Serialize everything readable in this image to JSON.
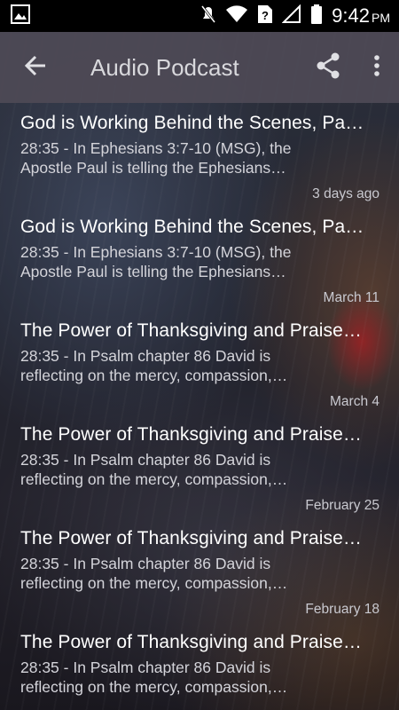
{
  "status_bar": {
    "time": "9:42",
    "ampm": "PM",
    "icons": [
      "image-icon",
      "mute-icon",
      "wifi-icon",
      "sim-unknown-icon",
      "signal-icon",
      "battery-icon"
    ]
  },
  "app_bar": {
    "title": "Audio Podcast",
    "back_icon": "arrow-back-icon",
    "share_icon": "share-icon",
    "more_icon": "more-vert-icon"
  },
  "episodes": [
    {
      "title": "God is Working Behind the Scenes, Pa…",
      "desc_line1": "28:35 - In Ephesians 3:7-10 (MSG), the",
      "desc_line2": "Apostle Paul is telling the Ephesians…",
      "date": "3 days ago"
    },
    {
      "title": "God is Working Behind the Scenes, Pa…",
      "desc_line1": "28:35 - In Ephesians 3:7-10 (MSG), the",
      "desc_line2": "Apostle Paul is telling the Ephesians…",
      "date": "March 11"
    },
    {
      "title": "The Power of Thanksgiving and Praise…",
      "desc_line1": "28:35 - In Psalm chapter 86 David is",
      "desc_line2": "reflecting on the mercy, compassion,…",
      "date": "March 4"
    },
    {
      "title": "The Power of Thanksgiving and Praise…",
      "desc_line1": "28:35 - In Psalm chapter 86 David is",
      "desc_line2": "reflecting on the mercy, compassion,…",
      "date": "February 25"
    },
    {
      "title": "The Power of Thanksgiving and Praise…",
      "desc_line1": "28:35 - In Psalm chapter 86 David is",
      "desc_line2": "reflecting on the mercy, compassion,…",
      "date": "February 18"
    },
    {
      "title": "The Power of Thanksgiving and Praise…",
      "desc_line1": "28:35 - In Psalm chapter 86 David is",
      "desc_line2": "reflecting on the mercy, compassion,…",
      "date": ""
    }
  ],
  "colors": {
    "status_bar_bg": "#000000",
    "app_bar_bg": "#4e4a56",
    "title_text": "#d8d8dc",
    "item_title": "#ffffff",
    "item_desc": "#d4d4da"
  }
}
